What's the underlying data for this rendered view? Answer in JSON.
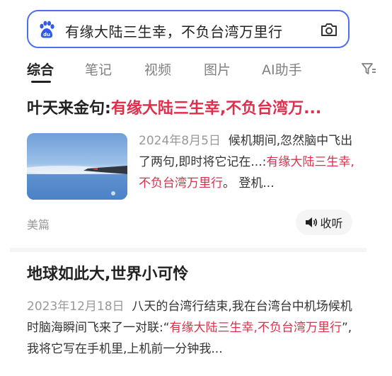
{
  "search": {
    "query": "有缘大陆三生幸，不负台湾万里行",
    "logo_icon": "baidu-paw-icon",
    "camera_icon": "camera-icon"
  },
  "tabs": [
    {
      "label": "综合",
      "active": true
    },
    {
      "label": "笔记"
    },
    {
      "label": "视频"
    },
    {
      "label": "图片"
    },
    {
      "label": "AI助手"
    }
  ],
  "filter_icon": "filter-icon",
  "results": [
    {
      "title_plain": "叶天来金句:",
      "title_highlight": "有缘大陆三生幸,不负台湾万...",
      "date": "2024年8月5日",
      "snippet_before": "候机期间,忽然脑中飞出了两句,即时将它记在...:",
      "snippet_highlight": "有缘大陆三生幸,不负台湾万里行",
      "snippet_after": "。 登机...",
      "source": "美篇",
      "listen_label": "收听"
    },
    {
      "title_plain": "地球如此大,世界小可怜",
      "date": "2023年12月18日",
      "snippet_before": "八天的台湾行结束,我在台湾台中机场候机时脑海瞬间飞来了一对联:“",
      "snippet_highlight": "有缘大陆三生幸,不负台湾万里行",
      "snippet_after": "”,我将它写在手机里,上机前一分钟我..."
    }
  ],
  "colors": {
    "accent": "#4e6ef2",
    "highlight": "#e02f4d",
    "muted": "#999999"
  }
}
